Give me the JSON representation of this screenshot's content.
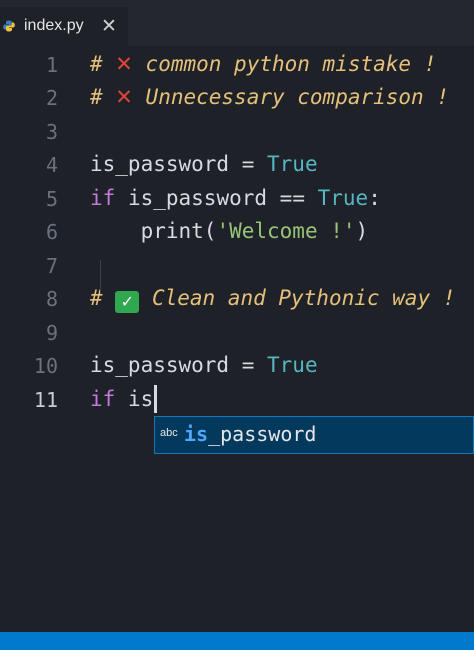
{
  "tab": {
    "filename": "index.py",
    "close_glyph": "✕",
    "icon": "python-icon"
  },
  "colors": {
    "comment": "#e5c07b",
    "keyword": "#c678dd",
    "constant": "#56b6c2",
    "string": "#98c379",
    "accent": "#007acc"
  },
  "lines": [
    {
      "number": "1",
      "hash": "# ",
      "mark": "✕",
      "text": " common python mistake !"
    },
    {
      "number": "2",
      "hash": "# ",
      "mark": "✕",
      "text": " Unnecessary comparison !"
    },
    {
      "number": "3"
    },
    {
      "number": "4",
      "name": "is_password",
      "op": " = ",
      "value": "True"
    },
    {
      "number": "5",
      "kw": "if",
      "name": " is_password ",
      "op": "==",
      "sp": " ",
      "value": "True",
      "colon": ":"
    },
    {
      "number": "6",
      "indent": "    ",
      "fn": "print(",
      "str": "'Welcome !'",
      "close": ")"
    },
    {
      "number": "7"
    },
    {
      "number": "8",
      "hash": "# ",
      "mark": "✓",
      "text": " Clean and Pythonic way !"
    },
    {
      "number": "9"
    },
    {
      "number": "10",
      "name": "is_password",
      "op": " = ",
      "value": "True"
    },
    {
      "number": "11",
      "kw": "if",
      "name": " is"
    }
  ],
  "suggestion": {
    "kind": "abc",
    "match": "is",
    "rest": "_password"
  }
}
